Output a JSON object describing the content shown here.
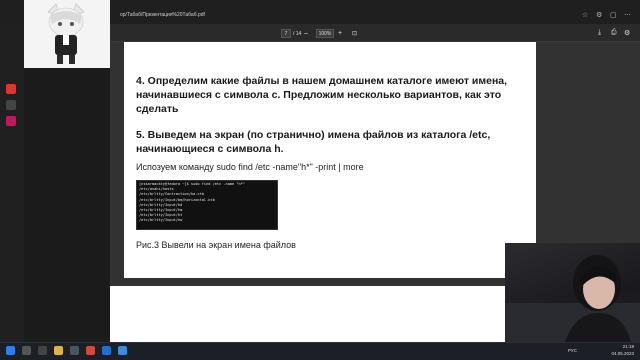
{
  "browser": {
    "url": "ор/Табаб/Презентация%20Табаб.pdf"
  },
  "pdf_toolbar": {
    "page_current": "7",
    "page_total": "/ 14",
    "zoom": "100%",
    "minus": "–",
    "plus": "+"
  },
  "page": {
    "heading4": "4. Определим какие файлы в нашем домашнем каталоге имеют имена, начинавшиеся с символа с. Предложим несколько вариантов, как это сделать",
    "heading5": "5. Выведем на экран (по странично) имена файлов из каталога /etc, начинающиеся с символа h.",
    "command_text": "Испозуем команду sudo find /etc -name\"h*\" -print | more",
    "caption": "Рис.3 Вывели на экран имена файлов"
  },
  "terminal": {
    "lines": [
      "[nskarmackty@fedora ~]$ sudo find /etc -name \"h*\"",
      "/etc/avahi/hosts",
      "/etc/brltty/Contraction/ha.ctb",
      "/etc/brltty/Input/bm/horizontal.ktb",
      "/etc/brltty/Input/hd",
      "/etc/brltty/Input/hm",
      "/etc/brltty/Input/ht",
      "/etc/brltty/Input/hw"
    ]
  },
  "taskbar": {
    "lang": "РУС",
    "time": "21:19",
    "date": "04.05.2023"
  },
  "colors": {
    "edge_accent": "#1f6fd1",
    "taskbar_bg": "#1c1f26"
  }
}
